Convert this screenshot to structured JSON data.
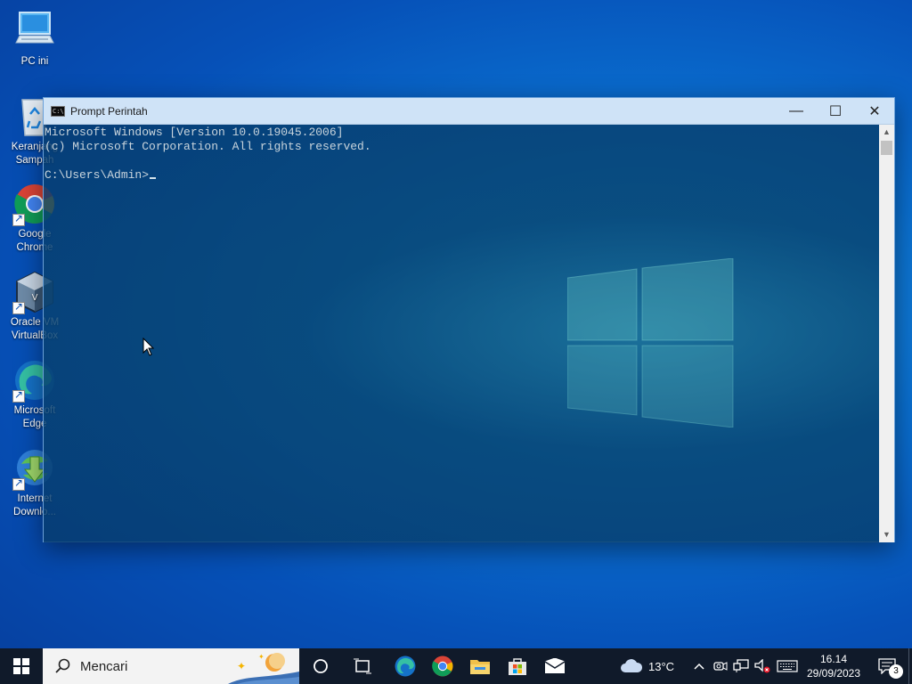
{
  "desktop": {
    "icons": [
      {
        "label": "PC ini",
        "icon": "computer-icon",
        "shortcut": false
      },
      {
        "label": "Keranjang\nSampah",
        "icon": "recycle-bin-icon",
        "shortcut": false
      },
      {
        "label": "Google\nChrome",
        "icon": "chrome-icon",
        "shortcut": true
      },
      {
        "label": "Oracle VM\nVirtualBox",
        "icon": "virtualbox-icon",
        "shortcut": true
      },
      {
        "label": "Microsoft\nEdge",
        "icon": "edge-icon",
        "shortcut": true
      },
      {
        "label": "Internet\nDownlo...",
        "icon": "internet-download-manager-icon",
        "shortcut": true
      }
    ]
  },
  "window": {
    "title": "Prompt Perintah",
    "controls": {
      "minimize": "—",
      "maximize": "☐",
      "close": "✕"
    },
    "console_lines": [
      "Microsoft Windows [Version 10.0.19045.2006]",
      "(c) Microsoft Corporation. All rights reserved.",
      "",
      "C:\\Users\\Admin>"
    ]
  },
  "taskbar": {
    "start_icon": "windows-start-icon",
    "search_placeholder": "Mencari",
    "pinned": [
      "cortana-icon",
      "task-view-icon",
      "edge-icon",
      "chrome-icon",
      "file-explorer-icon",
      "store-icon",
      "mail-icon"
    ],
    "weather": {
      "icon": "cloud-icon",
      "temp": "13°C"
    },
    "tray_icons": [
      "chevron-up-icon",
      "meet-now-icon",
      "network-icon",
      "volume-muted-icon",
      "keyboard-icon"
    ],
    "clock": {
      "time": "16.14",
      "date": "29/09/2023"
    },
    "notifications": {
      "count": "3"
    }
  },
  "colors": {
    "desktop_blue": "#0a6fd0",
    "taskbar": "#101a2a",
    "titlebar": "#cfe3f7",
    "console_text": "#c8d4dc"
  }
}
